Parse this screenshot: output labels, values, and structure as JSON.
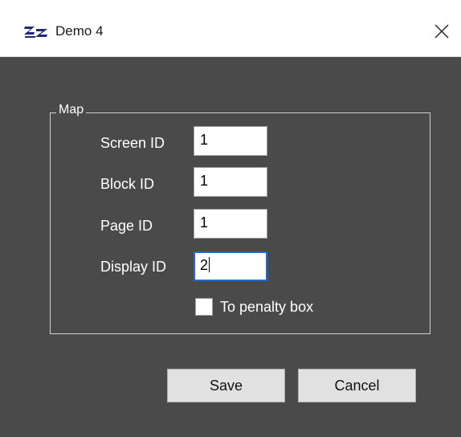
{
  "window": {
    "title": "Demo 4",
    "app_icon": "zz-logo-icon",
    "close_icon": "close-icon"
  },
  "group": {
    "legend": "Map"
  },
  "fields": [
    {
      "label": "Screen ID",
      "value": "1"
    },
    {
      "label": "Block ID",
      "value": "1"
    },
    {
      "label": "Page ID",
      "value": "1"
    },
    {
      "label": "Display ID",
      "value": "2"
    }
  ],
  "checkbox": {
    "label": "To penalty box",
    "checked": false
  },
  "buttons": {
    "save": "Save",
    "cancel": "Cancel"
  },
  "colors": {
    "background": "#4a4a4a",
    "focus_border": "#1e6ed0",
    "button_face": "#e1e1e1"
  }
}
